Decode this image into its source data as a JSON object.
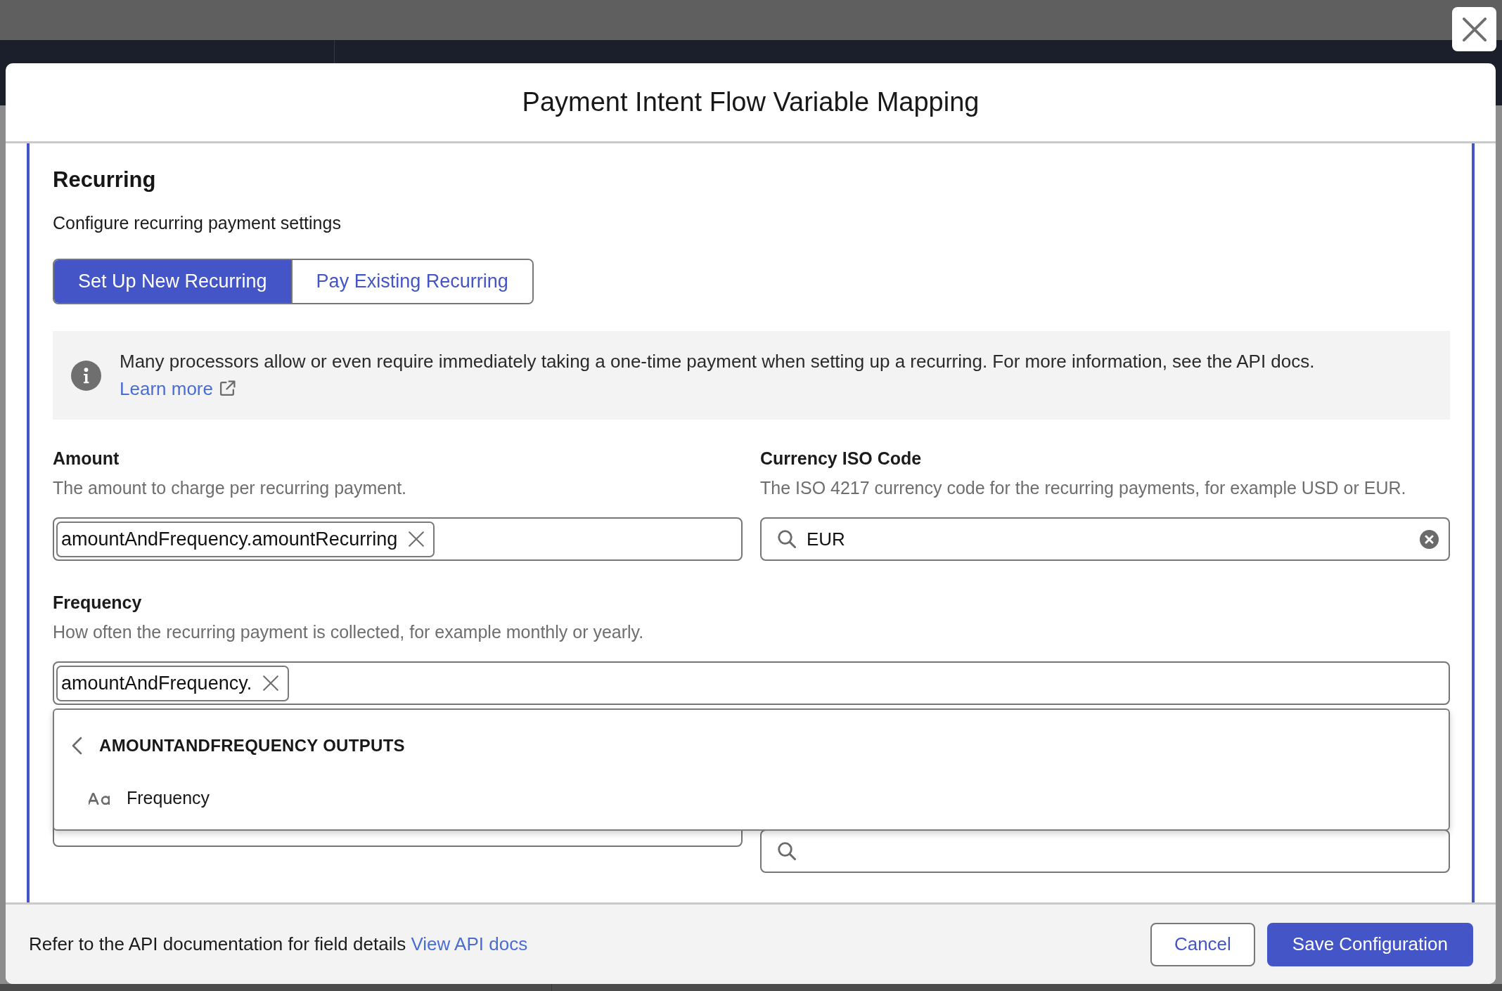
{
  "dialog": {
    "title": "Payment Intent Flow Variable Mapping",
    "section": {
      "title": "Recurring",
      "subtitle": "Configure recurring payment settings",
      "tabs": [
        {
          "label": "Set Up New Recurring",
          "selected": true
        },
        {
          "label": "Pay Existing Recurring",
          "selected": false
        }
      ],
      "notice": {
        "text": "Many processors allow or even require immediately taking a one-time payment when setting up a recurring. For more information, see the API docs.",
        "link": "Learn more"
      },
      "rows": [
        {
          "fields": [
            {
              "kind": "token",
              "label": "Amount",
              "description": "The amount to charge per recurring payment.",
              "token": "amountAndFrequency.amountRecurring"
            },
            {
              "kind": "search",
              "label": "Currency ISO Code",
              "description": "The ISO 4217 currency code for the recurring payments, for example USD or EUR.",
              "value": "EUR"
            }
          ]
        },
        {
          "fields": [
            {
              "kind": "token",
              "label": "Frequency",
              "description": "How often the recurring payment is collected, for example monthly or yearly.",
              "token": "amountAndFrequency.",
              "menu": {
                "title": "AMOUNTANDFREQUENCY OUTPUTS",
                "items": [
                  {
                    "kind": "text",
                    "label": "Frequency"
                  }
                ]
              }
            }
          ]
        },
        {
          "fields": [
            {
              "kind": "blank"
            },
            {
              "kind": "search"
            }
          ]
        }
      ]
    },
    "footer": {
      "note": "Refer to the API documentation for field details",
      "link": "View API docs",
      "buttons": [
        {
          "kind": "secondary",
          "label": "Cancel"
        },
        {
          "kind": "primary",
          "label": "Save Configuration"
        }
      ]
    }
  }
}
